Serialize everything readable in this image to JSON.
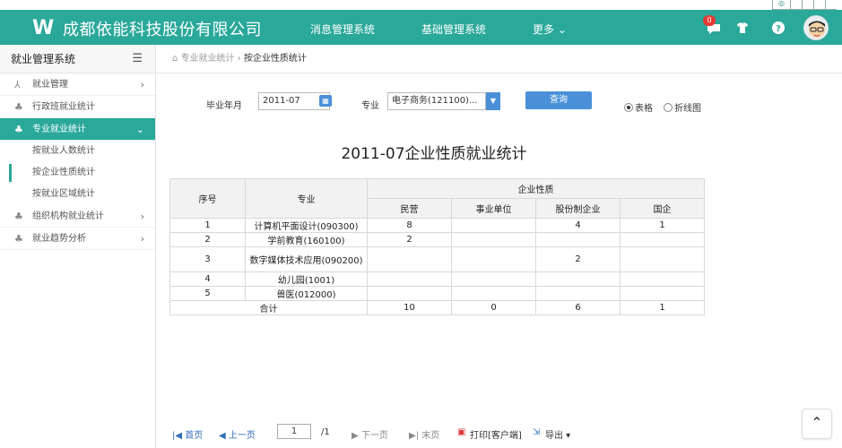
{
  "header": {
    "logo_text": "W",
    "company": "成都依能科技股份有限公司",
    "nav": [
      "消息管理系统",
      "基础管理系统",
      "更多 ⌄"
    ],
    "badge_count": "0",
    "accent_color": "#2aa89a"
  },
  "sidebar": {
    "title": "就业管理系统",
    "items": [
      {
        "label": "就业管理",
        "icon": "broom-icon",
        "arrow": "›"
      },
      {
        "label": "行政班就业统计",
        "icon": "org-chart-icon",
        "arrow": ""
      },
      {
        "label": "专业就业统计",
        "icon": "org-chart-icon",
        "arrow": "⌄"
      },
      {
        "label": "组织机构就业统计",
        "icon": "org-chart-icon",
        "arrow": "›"
      },
      {
        "label": "就业趋势分析",
        "icon": "org-chart-icon",
        "arrow": "›"
      }
    ],
    "subitems": [
      "按就业人数统计",
      "按企业性质统计",
      "按就业区域统计"
    ]
  },
  "breadcrumb": {
    "parent": "专业就业统计",
    "sep": "›",
    "current": "按企业性质统计"
  },
  "filter": {
    "year_label": "毕业年月",
    "year_value": "2011-07",
    "major_label": "专业",
    "major_value": "电子商务(121100)...",
    "query_button": "查询",
    "radio_table": "表格",
    "radio_line": "折线图"
  },
  "report": {
    "title": "2011-07企业性质就业统计",
    "headers": {
      "index": "序号",
      "major": "专业",
      "group": "企业性质",
      "cols": [
        "民营",
        "事业单位",
        "股份制企业",
        "国企"
      ]
    },
    "rows": [
      {
        "idx": "1",
        "major": "计算机平面设计(090300)",
        "v": [
          "8",
          "",
          "4",
          "1"
        ]
      },
      {
        "idx": "2",
        "major": "学前教育(160100)",
        "v": [
          "2",
          "",
          "",
          ""
        ]
      },
      {
        "idx": "3",
        "major": "数字媒体技术应用(090200)",
        "v": [
          "",
          "",
          "2",
          ""
        ]
      },
      {
        "idx": "4",
        "major": "幼儿园(1001)",
        "v": [
          "",
          "",
          "",
          ""
        ]
      },
      {
        "idx": "5",
        "major": "兽医(012000)",
        "v": [
          "",
          "",
          "",
          ""
        ]
      }
    ],
    "total": {
      "label": "合计",
      "v": [
        "10",
        "0",
        "6",
        "1"
      ]
    }
  },
  "pager": {
    "first": "|◀ 首页",
    "prev": "◀ 上一页",
    "page": "1",
    "total": "/1",
    "next": "▶ 下一页",
    "last": "▶| 末页",
    "print": "打印[客户端]",
    "export": "导出 ▾"
  }
}
